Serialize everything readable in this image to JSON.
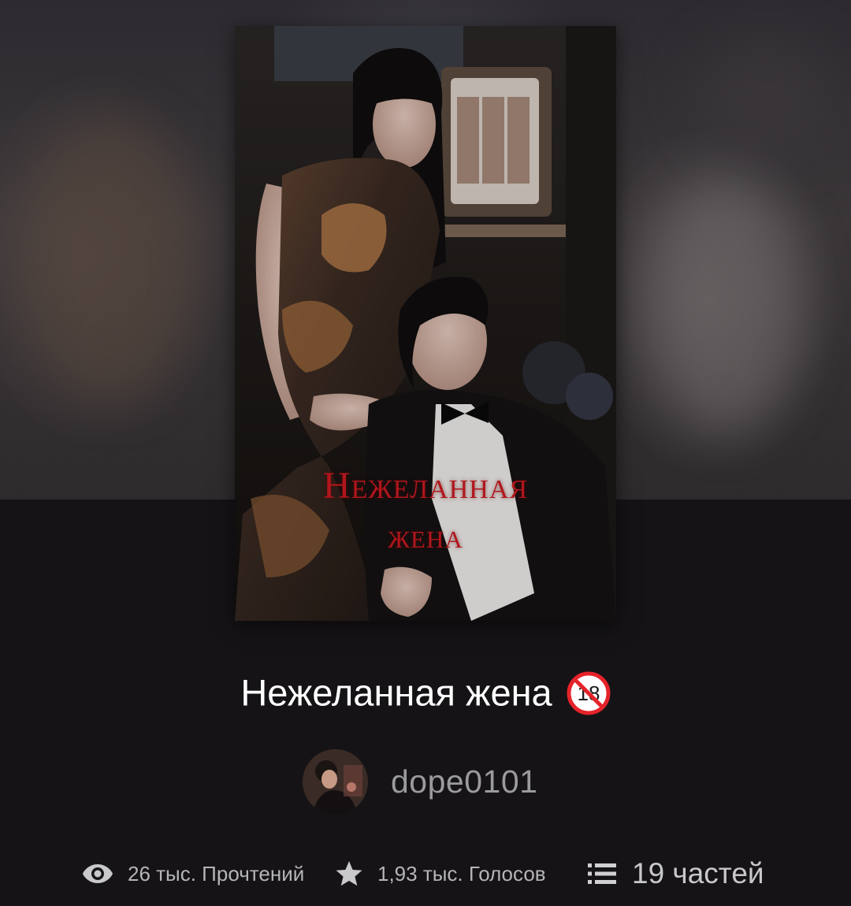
{
  "story": {
    "title": "Нежеланная жена",
    "rating_badge": "18",
    "cover": {
      "title_line1": "Нежеланная",
      "title_line2": "жена",
      "title_color": "#b0161c"
    }
  },
  "author": {
    "name": "dope0101"
  },
  "stats": {
    "reads": {
      "icon": "eye-icon",
      "label": "26 тыс. Прочтений"
    },
    "votes": {
      "icon": "star-icon",
      "label": "1,93 тыс. Голосов"
    },
    "parts": {
      "icon": "list-icon",
      "label": "19 частей"
    }
  },
  "colors": {
    "background": "#151316",
    "title_text": "#ffffff",
    "author_text": "#9b9a9c",
    "badge_red": "#e5232b"
  }
}
